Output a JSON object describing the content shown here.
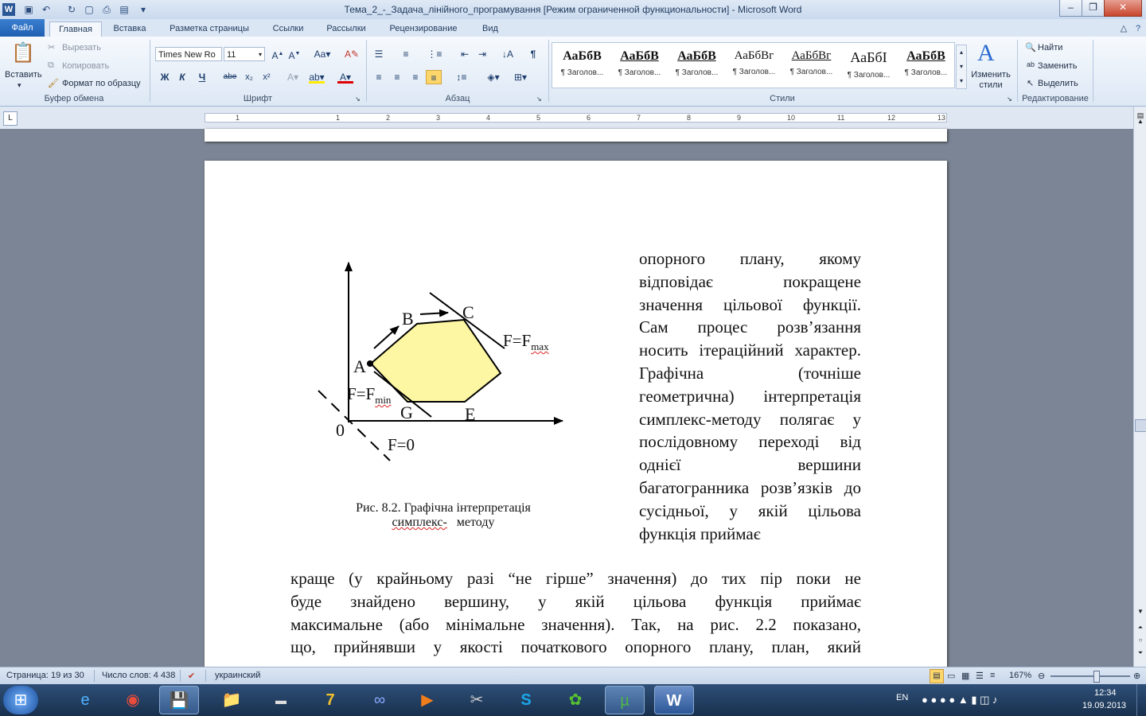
{
  "window": {
    "title": "Тема_2_-_Задача_лінійного_програмування [Режим ограниченной функциональности]  -  Microsoft Word"
  },
  "tabs": {
    "file": "Файл",
    "items": [
      "Главная",
      "Вставка",
      "Разметка страницы",
      "Ссылки",
      "Рассылки",
      "Рецензирование",
      "Вид"
    ]
  },
  "ribbon": {
    "clipboard": {
      "label": "Буфер обмена",
      "paste": "Вставить",
      "cut": "Вырезать",
      "copy": "Копировать",
      "format_painter": "Формат по образцу"
    },
    "font": {
      "label": "Шрифт",
      "font_name": "Times New Ro",
      "font_size": "11",
      "bold": "Ж",
      "italic": "К",
      "underline": "Ч",
      "strike": "abe"
    },
    "paragraph": {
      "label": "Абзац"
    },
    "styles": {
      "label": "Стили",
      "change_styles": "Изменить стили",
      "items": [
        {
          "sample": "АаБбВ",
          "name": "¶ Заголов..."
        },
        {
          "sample": "АаБбВ",
          "name": "¶ Заголов..."
        },
        {
          "sample": "АаБбВ",
          "name": "¶ Заголов..."
        },
        {
          "sample": "АаБбВг",
          "name": "¶ Заголов..."
        },
        {
          "sample": "АаБбВг",
          "name": "¶ Заголов..."
        },
        {
          "sample": "АаБбI",
          "name": "¶ Заголов..."
        },
        {
          "sample": "АаБбВ",
          "name": "¶ Заголов..."
        }
      ]
    },
    "editing": {
      "label": "Редактирование",
      "find": "Найти",
      "replace": "Заменить",
      "select": "Выделить"
    }
  },
  "ruler": {
    "ticks": [
      "1",
      "1",
      "2",
      "3",
      "4",
      "5",
      "6",
      "7",
      "8",
      "9",
      "10",
      "11",
      "12",
      "13"
    ]
  },
  "document": {
    "right_column": "опорного плану, якому відповідає покращене значення цільової функції. Сам процес розв’язання носить ітераційний характер. Графічна (точніше геометрична) інтерпретація симплекс-методу полягає у послідовному переході від однієї вершини багатогранника розв’язків до сусідньої, у якій цільова функція приймає",
    "full_width": [
      "краще (у крайньому разі “не гірше” значення) до тих пір поки не",
      "буде знайдено вершину, у якій цільова функція приймає",
      "максимальне (або мінімальне значення).  Так,  на рис. 2.2 показано,",
      "що, прийнявши у якості початкового опорного плану, план, який"
    ],
    "figure": {
      "labels": {
        "A": "A",
        "B": "B",
        "C": "C",
        "E": "E",
        "G": "G",
        "O": "0"
      },
      "fmax_base": "F=F",
      "fmax_sub": "max",
      "fmin_base": "F=F",
      "fmin_sub": "min",
      "f0": "F=0",
      "polygon_fill": "#fdf6a3"
    },
    "caption_line1": "Рис. 8.2. Графічна інтерпретація",
    "caption_word": "симплекс-",
    "caption_rest": "методу"
  },
  "statusbar": {
    "page": "Страница: 19 из 30",
    "words": "Число слов: 4 438",
    "language": "украинский",
    "zoom": "167%"
  },
  "taskbar": {
    "lang": "EN",
    "time": "12:34",
    "date": "19.09.2013"
  }
}
